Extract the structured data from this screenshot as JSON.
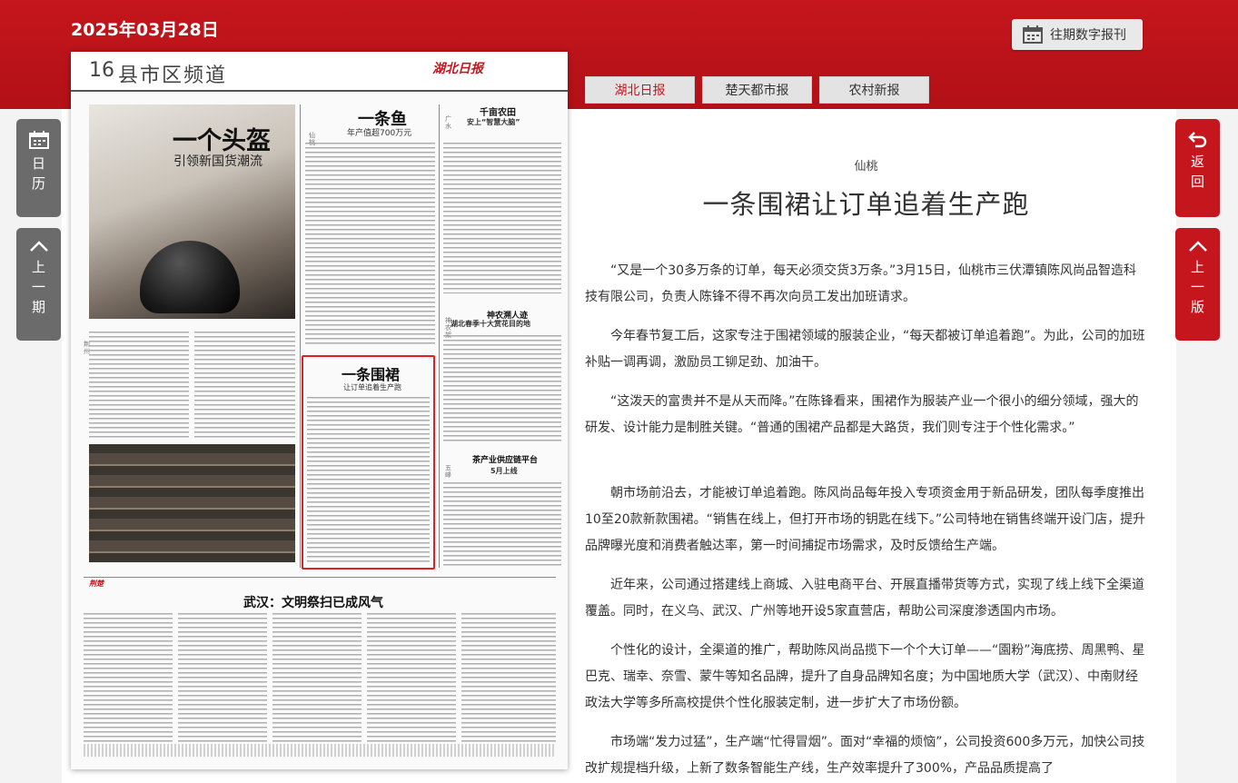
{
  "header": {
    "date": "2025年03月28日",
    "past_issues_button": "往期数字报刊"
  },
  "newspaper_page": {
    "page_number": "16",
    "page_name": "县市区频道",
    "masthead": "湖北日报",
    "headline_helmet": "一个头盔",
    "subhead_helmet": "引领新国货潮流",
    "headline_fish": "一条鱼",
    "subhead_fish": "年产值超700万元",
    "headline_farm": "千亩农田",
    "subhead_farm": "安上“智慧大脑”",
    "headline_apron": "一条围裙",
    "subhead_apron": "让订单追着生产跑",
    "headline_walnut": "神农溯人迹",
    "subhead_walnut": "湖北春季十大赏花目的地",
    "headline_supply": "茶产业供应链平台",
    "subhead_supply": "5月上线",
    "headline_wuhan": "武汉：文明祭扫已成风气",
    "section_tag": "荆楚",
    "col_label_1": "荆州",
    "col_label_2": "仙桃",
    "col_label_3": "广水",
    "col_label_4": "神农架",
    "col_label_5": "五峰"
  },
  "tabs": [
    {
      "label": "湖北日报",
      "active": true
    },
    {
      "label": "楚天都市报",
      "active": false
    },
    {
      "label": "农村新报",
      "active": false
    }
  ],
  "side_nav": {
    "calendar": "日历",
    "prev_issue": "上一期",
    "back": "返回",
    "prev_page": "上一版"
  },
  "article": {
    "author": "仙桃",
    "title": "一条围裙让订单追着生产跑",
    "paragraphs": [
      "“又是一个30多万条的订单，每天必须交货3万条。”3月15日，仙桃市三伏潭镇陈风尚品智造科技有限公司，负责人陈锋不得不再次向员工发出加班请求。",
      "今年春节复工后，这家专注于围裙领域的服装企业，“每天都被订单追着跑”。为此，公司的加班补贴一调再调，激励员工铆足劲、加油干。",
      "“这泼天的富贵并不是从天而降。”在陈锋看来，围裙作为服装产业一个很小的细分领域，强大的研发、设计能力是制胜关键。“普通的围裙产品都是大路货，我们则专注于个性化需求。”",
      "朝市场前沿去，才能被订单追着跑。陈风尚品每年投入专项资金用于新品研发，团队每季度推出10至20款新款围裙。“销售在线上，但打开市场的钥匙在线下。”公司特地在销售终端开设门店，提升品牌曝光度和消费者触达率，第一时间捕捉市场需求，及时反馈给生产端。",
      "近年来，公司通过搭建线上商城、入驻电商平台、开展直播带货等方式，实现了线上线下全渠道覆盖。同时，在义乌、武汉、广州等地开设5家直营店，帮助公司深度渗透国内市场。",
      "个性化的设计，全渠道的推广，帮助陈风尚品揽下一个个大订单——“園粉”海底捞、周黑鸭、星巴克、瑞幸、奈雪、蒙牛等知名品牌，提升了自身品牌知名度；为中国地质大学（武汉）、中南财经政法大学等多所高校提供个性化服装定制，进一步扩大了市场份额。",
      "市场端“发力过猛”，生产端“忙得冒烟”。面对“幸福的烦恼”，公司投资600多万元，加快公司技改扩规提档升级，上新了数条智能生产线，生产效率提升了300%，产品品质提高了"
    ]
  }
}
